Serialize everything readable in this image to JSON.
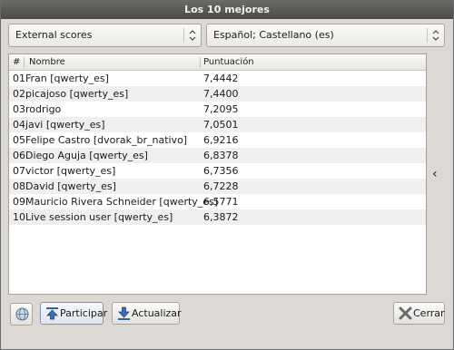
{
  "window": {
    "title": "Los 10 mejores"
  },
  "filters": {
    "source": "External scores",
    "language": "Español; Castellano (es)"
  },
  "table": {
    "headers": [
      "#",
      "Nombre",
      "Puntuación"
    ],
    "rows": [
      {
        "rank": "01",
        "name": "Fran [qwerty_es]",
        "score": "7,4442"
      },
      {
        "rank": "02",
        "name": "picajoso [qwerty_es]",
        "score": "7,4400"
      },
      {
        "rank": "03",
        "name": "rodrigo",
        "score": "7,2095"
      },
      {
        "rank": "04",
        "name": "javi [qwerty_es]",
        "score": "7,0501"
      },
      {
        "rank": "05",
        "name": "Felipe Castro [dvorak_br_nativo]",
        "score": "6,9216"
      },
      {
        "rank": "06",
        "name": "Diego Aguja [qwerty_es]",
        "score": "6,8378"
      },
      {
        "rank": "07",
        "name": "victor [qwerty_es]",
        "score": "6,7356"
      },
      {
        "rank": "08",
        "name": "David [qwerty_es]",
        "score": "6,7228"
      },
      {
        "rank": "09",
        "name": "Mauricio Rivera Schneider [qwerty_es]",
        "score": "6,5771"
      },
      {
        "rank": "10",
        "name": "Live session user [qwerty_es]",
        "score": "6,3872"
      }
    ]
  },
  "side": {
    "chevron": "‹"
  },
  "buttons": {
    "participate": "Participar",
    "update": "Actualizar",
    "close": "Cerrar"
  },
  "icons": {
    "globe": "globe-icon",
    "participate": "upload-arrow-icon",
    "update": "download-arrow-icon",
    "close": "close-x-icon"
  }
}
